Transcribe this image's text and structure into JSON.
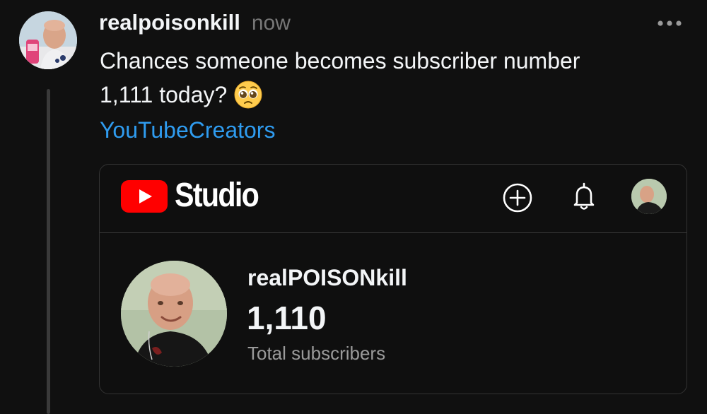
{
  "post": {
    "username": "realpoisonkill",
    "timestamp": "now",
    "text_line1": "Chances someone becomes subscriber number",
    "text_line2": "1,111 today?",
    "emoji": "pleading-face-emoji",
    "tag": "YouTubeCreators"
  },
  "card": {
    "app_name": "Studio",
    "channel_name": "realPOISONkill",
    "subscriber_count": "1,110",
    "subscriber_label": "Total subscribers"
  },
  "icons": {
    "more": "more-horizontal-icon",
    "youtube_logo": "youtube-logo-icon",
    "create": "create-plus-icon",
    "notifications": "bell-icon"
  },
  "colors": {
    "background": "#101010",
    "text_primary": "#f3f5f7",
    "text_secondary": "#777777",
    "link": "#2f9cf0",
    "youtube_red": "#ff0000",
    "card_border": "#333333"
  }
}
